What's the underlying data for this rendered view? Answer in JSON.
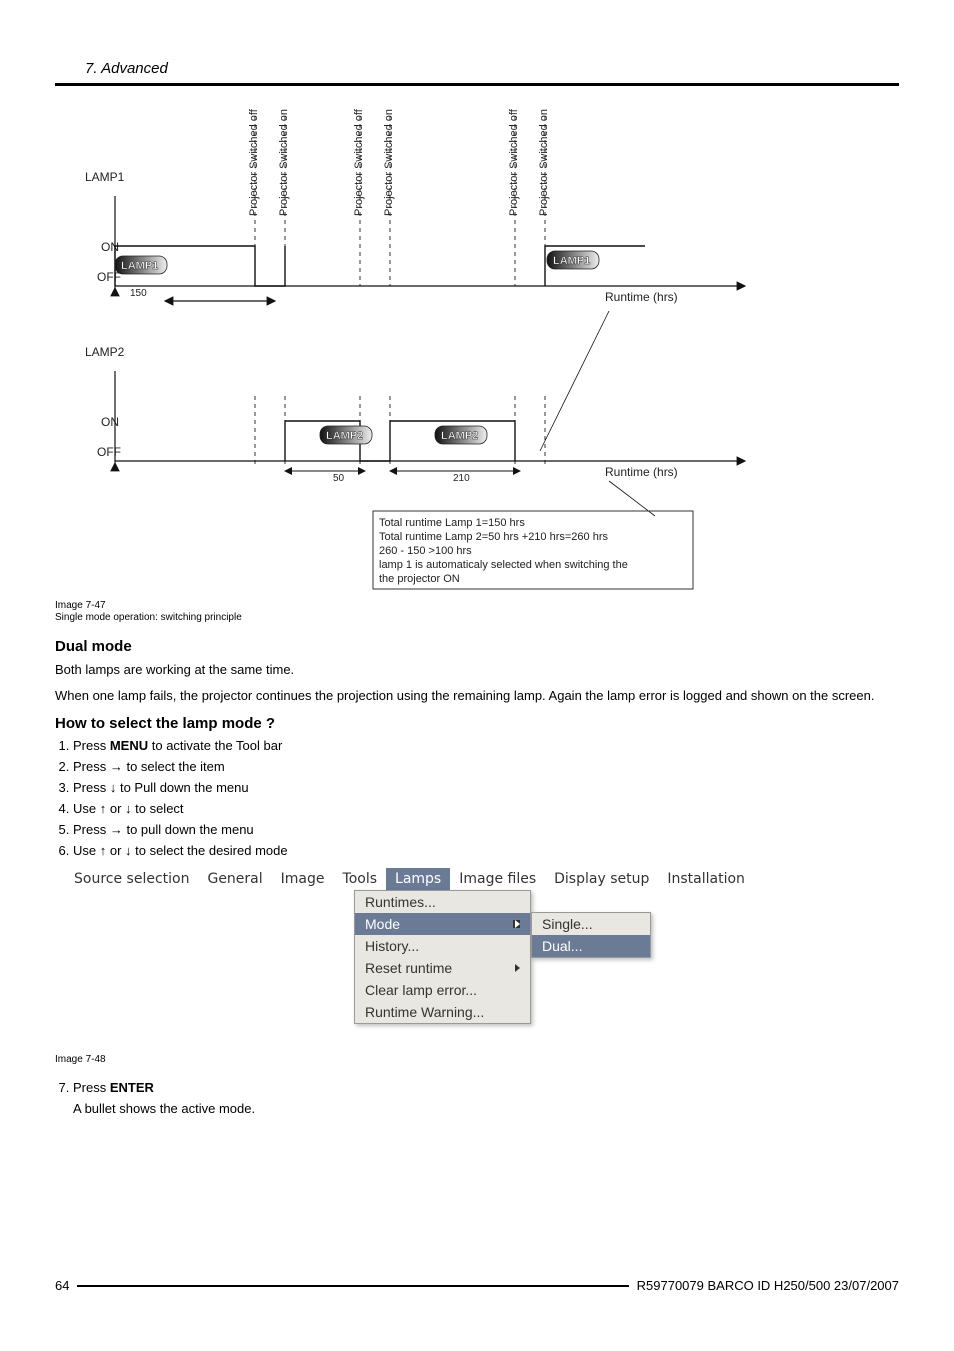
{
  "header": {
    "title": "7.  Advanced"
  },
  "figure47": {
    "caption_line1": "Image 7-47",
    "caption_line2": "Single mode operation: switching principle",
    "lamp1_label": "LAMP1",
    "lamp2_label": "LAMP2",
    "on": "ON",
    "off": "OFF",
    "runtime_axis": "Runtime (hrs)",
    "proj_off": "Projector Switched off",
    "proj_on": "Projector Switched on",
    "pill_lamp1": "LAMP1",
    "pill_lamp2": "LAMP2",
    "tick150": "150",
    "tick50": "50",
    "tick210": "210",
    "info1": "Total runtime Lamp 1=150 hrs",
    "info2": "Total runtime Lamp 2=50 hrs +210 hrs=260 hrs",
    "info3": "260 - 150 >100 hrs",
    "info4": "lamp 1 is automaticaly selected when switching the",
    "info5": "the projector ON"
  },
  "dualmode": {
    "heading": "Dual mode",
    "p1": "Both lamps are working at the same time.",
    "p2": "When one lamp fails, the projector continues the projection using the remaining lamp. Again the lamp error is logged and shown on the screen."
  },
  "howto": {
    "heading": "How to select the lamp mode ?",
    "s1a": "Press ",
    "s1b": "MENU",
    "s1c": " to activate the Tool bar",
    "s2a": "Press → to select the ",
    "s2b": "",
    "s2c": " item",
    "s3a": "Press ↓ to Pull down the ",
    "s3b": "",
    "s3c": " menu",
    "s4": "Use ↑ or ↓ to select",
    "s5": "Press → to pull down the menu",
    "s6": "Use ↑ or ↓ to select the desired mode",
    "s7a": "Press ",
    "s7b": "ENTER",
    "s7_note": "A bullet shows the active mode."
  },
  "menu": {
    "bar": [
      "Source selection",
      "General",
      "Image",
      "Tools",
      "Lamps",
      "Image files",
      "Display setup",
      "Installation"
    ],
    "selected_bar_index": 4,
    "lamps_items": [
      {
        "label": "Runtimes..."
      },
      {
        "label": "Mode",
        "selected": true,
        "arrow": true
      },
      {
        "label": "History..."
      },
      {
        "label": "Reset runtime",
        "arrow": true
      },
      {
        "label": "Clear lamp error..."
      },
      {
        "label": "Runtime Warning..."
      }
    ],
    "mode_items": [
      {
        "label": "Single..."
      },
      {
        "label": "Dual...",
        "selected": true
      }
    ]
  },
  "figure48_caption": "Image 7-48",
  "footer": {
    "page": "64",
    "right": "R59770079   BARCO ID H250/500  23/07/2007"
  }
}
